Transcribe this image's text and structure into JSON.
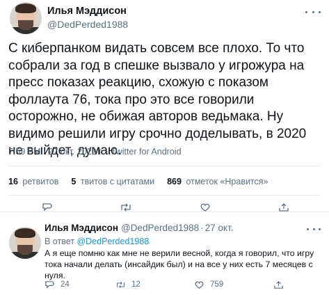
{
  "main_tweet": {
    "author_name": "Илья Мэддисон",
    "author_handle": "@DedPerded1988",
    "text": "С киберпанком видать совсем все плохо. То что собрали за год в спешке вызвало у игрожура на пресс показах реакцию, схожую с показом фоллаута 76, тока про это все говорили осторожно, не обижая авторов ведьмака. Ну видимо решили игру срочно доделывать, в 2020 не выйдет, думаю.",
    "meta": "7:59 PM · 27 окт. 2020 г. · Twitter for Android",
    "stats": {
      "retweets_count": "16",
      "retweets_label": "ретвитов",
      "quotes_count": "5",
      "quotes_label": "твитов с цитатами",
      "likes_count": "869",
      "likes_label": "отметок «Нравится»"
    }
  },
  "reply_tweet": {
    "author_name": "Илья Мэддисон",
    "author_handle": "@DedPerded1988",
    "separator": "·",
    "time": "27 окт.",
    "reply_to_prefix": "В ответ",
    "reply_to_handle": "@DedPerded1988",
    "text": "А я еще помню как мне не верили весной, когда я говорил, что игру тока начали делать (инсайдик был) и на все у них есть 7 месяцев с нуля.",
    "replies_count": "24",
    "retweets_count": "12",
    "likes_count": "759"
  },
  "colors": {
    "text": "#0f1419",
    "secondary": "#5b7083",
    "link": "#1b95e0",
    "divider": "#e6ecf0"
  }
}
